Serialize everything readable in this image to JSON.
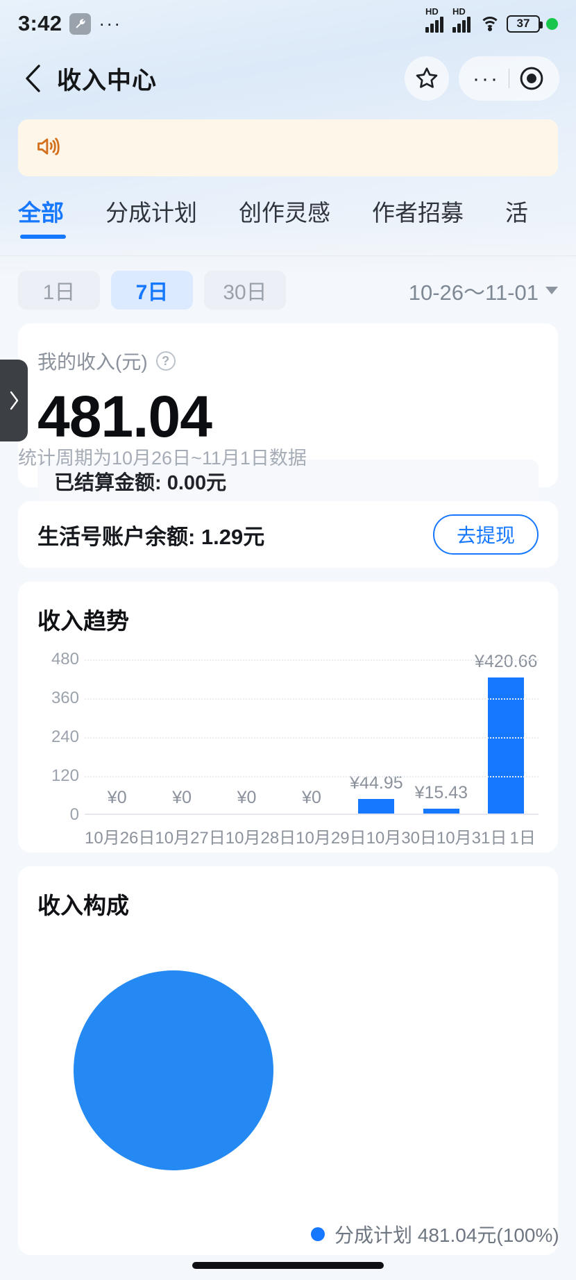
{
  "status_bar": {
    "time": "3:42",
    "wrench_icon": "wrench-icon",
    "overflow_dots": "···",
    "hd_label_1": "HD",
    "hd_label_2": "HD",
    "battery_level": "37"
  },
  "header": {
    "back_icon": "back-chevron-icon",
    "title": "收入中心",
    "favorite_icon": "star-icon",
    "more_dots": "···",
    "target_icon": "record-target-icon"
  },
  "notice": {
    "speaker_icon": "speaker-icon",
    "text": ""
  },
  "tabs": [
    {
      "label": "全部",
      "active": true
    },
    {
      "label": "分成计划",
      "active": false
    },
    {
      "label": "创作灵感",
      "active": false
    },
    {
      "label": "作者招募",
      "active": false
    },
    {
      "label": "活",
      "active": false
    }
  ],
  "range": {
    "chips": [
      {
        "label": "1日",
        "active": false
      },
      {
        "label": "7日",
        "active": true
      },
      {
        "label": "30日",
        "active": false
      }
    ],
    "date_text": "10-26～11-01",
    "caret_icon": "chevron-down-icon"
  },
  "income_card": {
    "label": "我的收入(元)",
    "help_icon": "question-mark-icon",
    "amount": "481.04",
    "settled_text": "已结算金额: 0.00元",
    "period_note": "统计周期为10月26日~11月1日数据"
  },
  "balance_card": {
    "text": "生活号账户余额: 1.29元",
    "withdraw_label": "去提现"
  },
  "trend_card": {
    "title": "收入趋势"
  },
  "composition_card": {
    "title": "收入构成",
    "legend_label": "分成计划 481.04元(100%)"
  },
  "side_handle": {
    "icon": "chevron-right-icon"
  },
  "colors": {
    "accent": "#1677ff",
    "bar": "#1677ff",
    "pie": "#2489f2",
    "notice_bg": "#fef7e9",
    "battery_dot": "#17c64a"
  },
  "chart_data": [
    {
      "type": "bar",
      "title": "收入趋势",
      "xlabel": "",
      "ylabel": "",
      "ylim": [
        0,
        480
      ],
      "yticks": [
        "0",
        "120",
        "240",
        "360",
        "480"
      ],
      "grid": true,
      "categories": [
        "10月26日",
        "10月27日",
        "10月28日",
        "10月29日",
        "10月30日",
        "10月31日",
        "1日"
      ],
      "values": [
        0,
        0,
        0,
        0,
        44.95,
        15.43,
        420.66
      ],
      "data_labels": [
        "¥0",
        "¥0",
        "¥0",
        "¥0",
        "¥44.95",
        "¥15.43",
        "¥420.66"
      ]
    },
    {
      "type": "pie",
      "title": "收入构成",
      "legend_position": "right",
      "labels": [
        "分成计划"
      ],
      "values": [
        481.04
      ],
      "percentages": [
        100
      ],
      "legend_entries": [
        "分成计划 481.04元(100%)"
      ]
    }
  ]
}
